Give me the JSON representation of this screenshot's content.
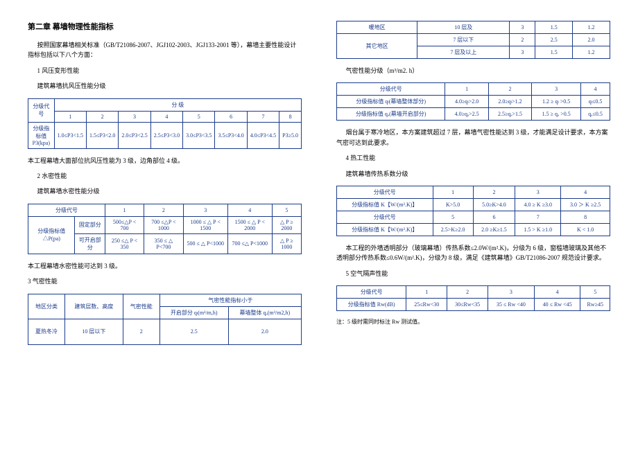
{
  "title": "第二章 幕墙物理性能指标",
  "intro": "按照国家幕墙相关标准（GB/T21086-2007、JGJ102-2003、JGJ133-2001 等），幕墙主要性能设计指标包括以下八个方面：",
  "s1": {
    "heading": "1 风压变形性能",
    "subtitle": "建筑幕墙抗风压性能分级",
    "h0": "分级代号",
    "hcat": "分 级",
    "c1": "1",
    "c2": "2",
    "c3": "3",
    "c4": "4",
    "c5": "5",
    "c6": "6",
    "c7": "7",
    "c8": "8",
    "h1": "分级指标值P3(kpa)",
    "v1": "1.0≤P3<1.5",
    "v2": "1.5≤P3<2.0",
    "v3": "2.0≤P3<2.5",
    "v4": "2.5≤P3<3.0",
    "v5": "3.0≤P3<3.5",
    "v6": "3.5≤P3<4.0",
    "v7": "4.0≤P3<4.5",
    "v8": "P3≥5.0",
    "concl": "本工程幕墙大面部位抗风压性能为 3 级，边角部位 4 级。"
  },
  "s2": {
    "heading": "2 水密性能",
    "subtitle": "建筑幕墙水密性能分级",
    "h0": "分级代号",
    "c1": "1",
    "c2": "2",
    "c3": "3",
    "c4": "4",
    "c5": "5",
    "h1": "分级指标值△P(pa)",
    "r1": "固定部分",
    "r1v1": "500≤△P < 700",
    "r1v2": "700 ≤△P < 1000",
    "r1v3": "1000 ≤ △ P < 1500",
    "r1v4": "1500 ≤ △ P < 2000",
    "r1v5": "△ P ≥ 2000",
    "r2": "可开启部分",
    "r2v1": "250 ≤△ P < 350",
    "r2v2": "350 ≤ △ P<700",
    "r2v3": "500 ≤ △ P<1000",
    "r2v4": "700 ≤△ P<1000",
    "r2v5": "△ P ≥ 1000",
    "concl": "本工程幕墙水密性能可达到 3 级。"
  },
  "s3": {
    "heading": "3 气密性能",
    "h0": "地区分类",
    "h1": "建筑层数、高度",
    "h2": "气密性能",
    "h3": "气密性能指标小于",
    "h3a": "开启部分 qₗ(m³/m,h)",
    "h3b": "幕墙整体 qₐ(m³/m2,h)",
    "r1a": "夏热冬冷",
    "r1b": "10 层以下",
    "r1c": "2",
    "r1d": "2.5",
    "r1e": "2.0"
  },
  "s3b": {
    "h0": "暖地区",
    "r0a": "10 层及",
    "r0b": "3",
    "r0c": "1.5",
    "r0d": "1.2",
    "h1": "其它地区",
    "r1a": "7 层以下",
    "r1b": "2",
    "r1c": "2.5",
    "r1d": "2.0",
    "r2a": "7 层及以上",
    "r2b": "3",
    "r2c": "1.5",
    "r2d": "1.2",
    "title": "气密性能分级（m³/m2. h）",
    "t2h0": "分级代号",
    "t2c1": "1",
    "t2c2": "2",
    "t2c3": "3",
    "t2c4": "4",
    "t2r1": "分级指标值 qₗ(幕墙整体部分)",
    "t2r1v1": "4.0≥qₗ>2.0",
    "t2r1v2": "2.0≥qₗ>1.2",
    "t2r1v3": "1.2 ≥ qₗ >0.5",
    "t2r1v4": "qₗ≤0.5",
    "t2r2": "分级指标值 qₐ(幕墙开启部分)",
    "t2r2v1": "4.0≥qₐ>2.5",
    "t2r2v2": "2.5≥qₐ>1.5",
    "t2r2v3": "1.5 ≥ qₐ >0.5",
    "t2r2v4": "qₐ≤0.5",
    "concl": "烟台属于寒冷地区，本方案建筑超过 7 层，幕墙气密性能达到 3 级，才能满足设计要求，本方案气密可达到此要求。"
  },
  "s4": {
    "heading": "4 热工性能",
    "subtitle": "建筑幕墙传热系数分级",
    "h0": "分级代号",
    "c1": "1",
    "c2": "2",
    "c3": "3",
    "c4": "4",
    "r1": "分级指标值 K【W/(m².K)】",
    "r1v1": "K>5.0",
    "r1v2": "5.0≥K>4.0",
    "r1v3": "4.0 ≥ K ≥3.0",
    "r1v4": "3.0 ＞ K ≥2.5",
    "h0b": "分级代号",
    "c5": "5",
    "c6": "6",
    "c7": "7",
    "c8": "8",
    "r2": "分级指标值 K【W/(m².K)】",
    "r2v1": "2.5>K≥2.0",
    "r2v2": "2.0 ≥K≥1.5",
    "r2v3": "1.5 > K ≥1.0",
    "r2v4": "K < 1.0",
    "concl": "本工程的外墙透明部分（玻璃幕墙）传热系数≤2.0W/(m².K)，分级为 6 级，窗槛墙玻璃及其他不透明部分传热系数≤0.6W/(m².K)，分级为 8 级，满足《建筑幕墙》GB/T21086-2007 规范设计要求。"
  },
  "s5": {
    "heading": "5 空气隔声性能",
    "h0": "分级代号",
    "c1": "1",
    "c2": "2",
    "c3": "3",
    "c4": "4",
    "c5": "5",
    "r1": "分级指标值 Rw(dB)",
    "r1v1": "25≤Rw<30",
    "r1v2": "30≤Rw<35",
    "r1v3": "35 ≤ Rw <40",
    "r1v4": "40 ≤ Rw <45",
    "r1v5": "Rw≥45",
    "note": "注：5 级时需同时标注 Rw 测试值。"
  }
}
